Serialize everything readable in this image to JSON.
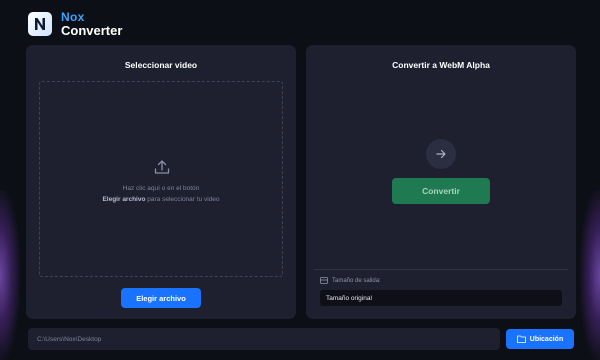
{
  "app": {
    "name_top": "Nox",
    "name_bottom": "Converter"
  },
  "left_panel": {
    "title": "Seleccionar video",
    "drop_line1": "Haz clic aquí o en el botón",
    "drop_strong": "Elegir archivo",
    "drop_rest": " para seleccionar tu video",
    "choose_button": "Elegir archivo"
  },
  "right_panel": {
    "title": "Convertir a WebM Alpha",
    "convert_button": "Convertir",
    "size_label": "Tamaño de salida:",
    "size_value": "Tamaño original"
  },
  "footer": {
    "path": "C:\\Users\\Nox\\Desktop",
    "location_button": "Ubicación"
  },
  "icons": {
    "logo": "nox-logo-icon",
    "upload": "upload-icon",
    "arrow": "arrow-right-icon",
    "size": "resize-icon",
    "folder": "folder-icon"
  },
  "colors": {
    "accent_blue": "#1a73ff",
    "convert_green": "#1f7a52",
    "panel": "#1e2030",
    "background": "#0d0f16",
    "brand_blue": "#3ba4ff"
  }
}
